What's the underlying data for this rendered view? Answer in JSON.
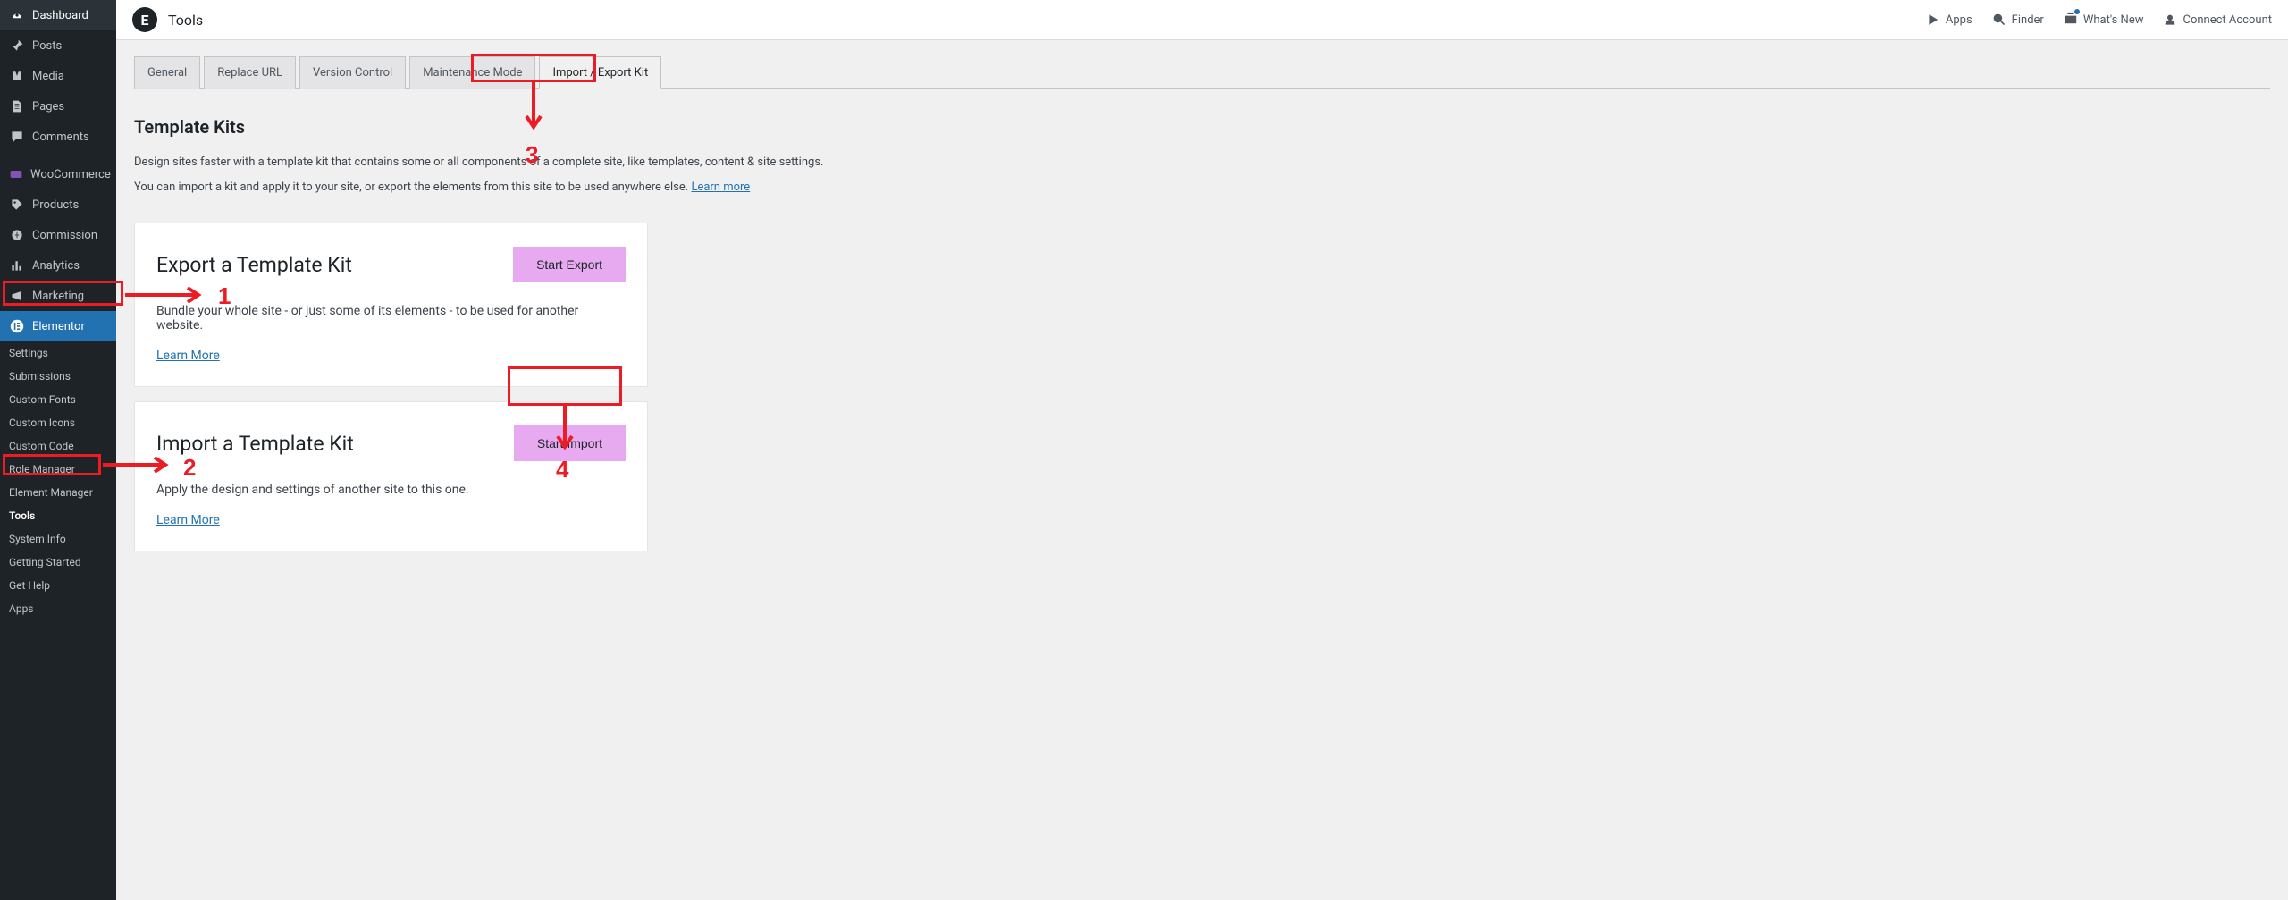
{
  "sidebar": {
    "main": [
      {
        "label": "Dashboard",
        "icon": "dashboard"
      },
      {
        "label": "Posts",
        "icon": "pin"
      },
      {
        "label": "Media",
        "icon": "media"
      },
      {
        "label": "Pages",
        "icon": "pages"
      },
      {
        "label": "Comments",
        "icon": "comments"
      },
      {
        "label": "WooCommerce",
        "icon": "woo"
      },
      {
        "label": "Products",
        "icon": "products"
      },
      {
        "label": "Commission",
        "icon": "commission"
      },
      {
        "label": "Analytics",
        "icon": "analytics"
      },
      {
        "label": "Marketing",
        "icon": "marketing"
      },
      {
        "label": "Elementor",
        "icon": "elementor",
        "active": true
      }
    ],
    "sub": [
      {
        "label": "Settings"
      },
      {
        "label": "Submissions"
      },
      {
        "label": "Custom Fonts"
      },
      {
        "label": "Custom Icons"
      },
      {
        "label": "Custom Code"
      },
      {
        "label": "Role Manager"
      },
      {
        "label": "Element Manager"
      },
      {
        "label": "Tools",
        "current": true
      },
      {
        "label": "System Info"
      },
      {
        "label": "Getting Started"
      },
      {
        "label": "Get Help"
      },
      {
        "label": "Apps"
      }
    ]
  },
  "topbar": {
    "title": "Tools",
    "right": [
      {
        "label": "Apps",
        "icon": "play"
      },
      {
        "label": "Finder",
        "icon": "search"
      },
      {
        "label": "What's New",
        "icon": "gift",
        "badge": true
      },
      {
        "label": "Connect Account",
        "icon": "user"
      }
    ]
  },
  "tabs": [
    {
      "label": "General"
    },
    {
      "label": "Replace URL"
    },
    {
      "label": "Version Control"
    },
    {
      "label": "Maintenance Mode"
    },
    {
      "label": "Import / Export Kit",
      "active": true
    }
  ],
  "heading": "Template Kits",
  "intro1": "Design sites faster with a template kit that contains some or all components of a complete site, like templates, content & site settings.",
  "intro2a": "You can import a kit and apply it to your site, or export the elements from this site to be used anywhere else. ",
  "intro2_link": "Learn more",
  "cards": {
    "export": {
      "title": "Export a Template Kit",
      "button": "Start Export",
      "desc": "Bundle your whole site - or just some of its elements - to be used for another website.",
      "learn": "Learn More"
    },
    "import": {
      "title": "Import a Template Kit",
      "button": "Start Import",
      "desc": "Apply the design and settings of another site to this one.",
      "learn": "Learn More"
    }
  },
  "annotations": {
    "n1": "1",
    "n2": "2",
    "n3": "3",
    "n4": "4"
  }
}
